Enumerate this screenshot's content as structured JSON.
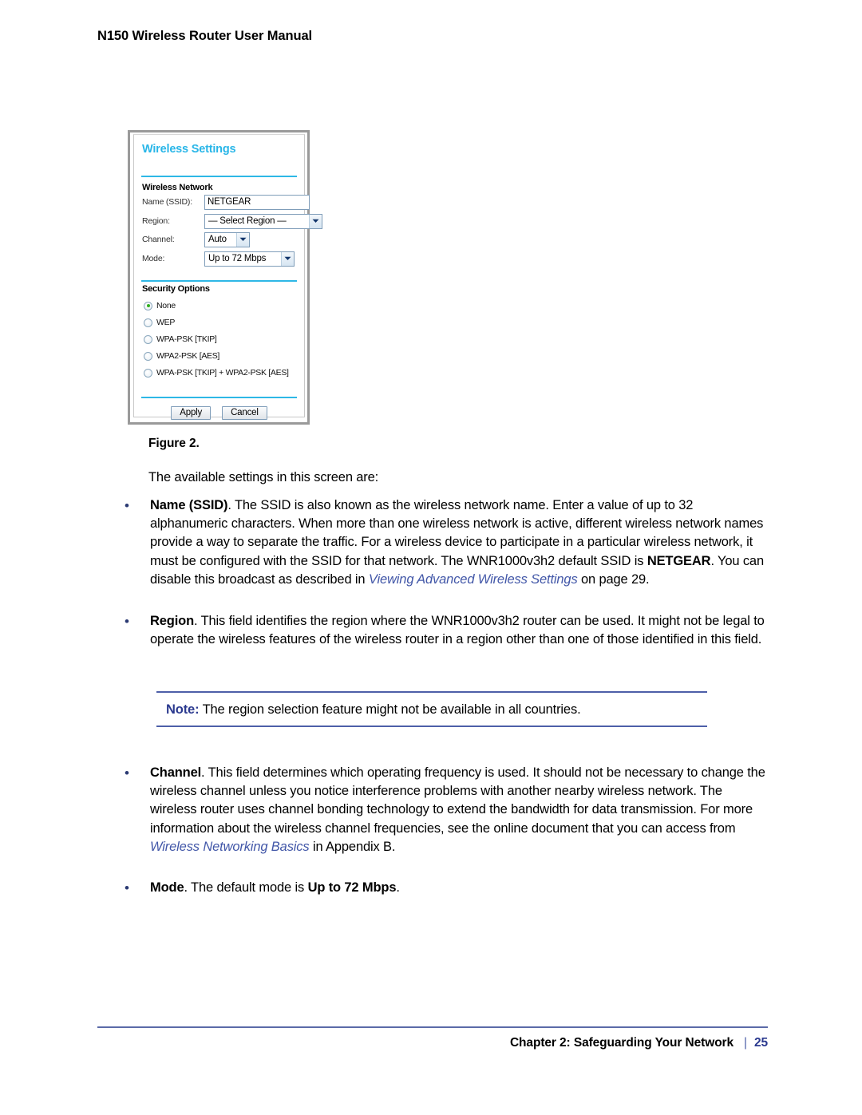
{
  "header": {
    "running_title": "N150 Wireless Router User Manual"
  },
  "figure": {
    "caption": "Figure 2.",
    "screenshot": {
      "panel_title": "Wireless Settings",
      "sections": {
        "network": {
          "label": "Wireless Network",
          "fields": [
            {
              "label": "Name (SSID):",
              "type": "text",
              "value": "NETGEAR"
            },
            {
              "label": "Region:",
              "type": "select",
              "value": "— Select Region —"
            },
            {
              "label": "Channel:",
              "type": "select",
              "value": "Auto"
            },
            {
              "label": "Mode:",
              "type": "select",
              "value": "Up to 72 Mbps"
            }
          ]
        },
        "security": {
          "label": "Security Options",
          "options": [
            {
              "label": "None",
              "selected": true
            },
            {
              "label": "WEP",
              "selected": false
            },
            {
              "label": "WPA-PSK [TKIP]",
              "selected": false
            },
            {
              "label": "WPA2-PSK [AES]",
              "selected": false
            },
            {
              "label": "WPA-PSK [TKIP] + WPA2-PSK [AES]",
              "selected": false
            }
          ]
        }
      },
      "buttons": {
        "apply": "Apply",
        "cancel": "Cancel"
      },
      "colors": {
        "panel_title": "#29b6e8",
        "divider": "#2eb8e6",
        "radio_selected_dot": "#2fae1f",
        "field_border": "#7f9db9"
      }
    }
  },
  "main": {
    "intro": "The available settings in this screen are:",
    "bullet_marker": "•",
    "bullets": [
      {
        "name": "name-ssid",
        "parts": [
          {
            "style": "bold",
            "text": "Name (SSID)"
          },
          {
            "style": "normal",
            "text": ". The SSID is also known as the wireless network name. Enter a value of up to 32 alphanumeric characters. When more than one wireless network is active, different wireless network names provide a way to separate the traffic. For a wireless device to participate in a particular wireless network, it must be configured with the SSID for that network. The WNR1000v3h2 default SSID is "
          },
          {
            "style": "bold",
            "text": "NETGEAR"
          },
          {
            "style": "normal",
            "text": ". You can disable this broadcast as described in "
          },
          {
            "style": "xref",
            "text": "Viewing Advanced Wireless Settings"
          },
          {
            "style": "normal",
            "text": " on page 29."
          }
        ]
      },
      {
        "name": "region",
        "parts": [
          {
            "style": "bold",
            "text": "Region"
          },
          {
            "style": "normal",
            "text": ". This field identifies the region where the WNR1000v3h2 router can be used. It might not be legal to operate the wireless features of the wireless router in a region other than one of those identified in this field."
          }
        ]
      }
    ],
    "note": {
      "label": "Note:",
      "text": "The region selection feature might not be available in all countries."
    },
    "bullets_after_note": [
      {
        "name": "channel",
        "parts": [
          {
            "style": "bold",
            "text": "Channel"
          },
          {
            "style": "normal",
            "text": ". This field determines which operating frequency is used. It should not be necessary to change the wireless channel unless you notice interference problems with another nearby wireless network. The wireless router uses channel bonding technology to extend the bandwidth for data transmission. For more information about the wireless channel frequencies, see the online document that you can access from "
          },
          {
            "style": "xref",
            "text": "Wireless Networking Basics"
          },
          {
            "style": "normal",
            "text": " in Appendix B."
          }
        ]
      },
      {
        "name": "mode",
        "parts": [
          {
            "style": "bold",
            "text": "Mode"
          },
          {
            "style": "normal",
            "text": ". The default mode is "
          },
          {
            "style": "bold",
            "text": "Up to 72 Mbps"
          },
          {
            "style": "normal",
            "text": "."
          }
        ]
      }
    ]
  },
  "footer": {
    "chapter": "Chapter 2:  Safeguarding Your Network",
    "separator": "|",
    "page_number": "25"
  }
}
